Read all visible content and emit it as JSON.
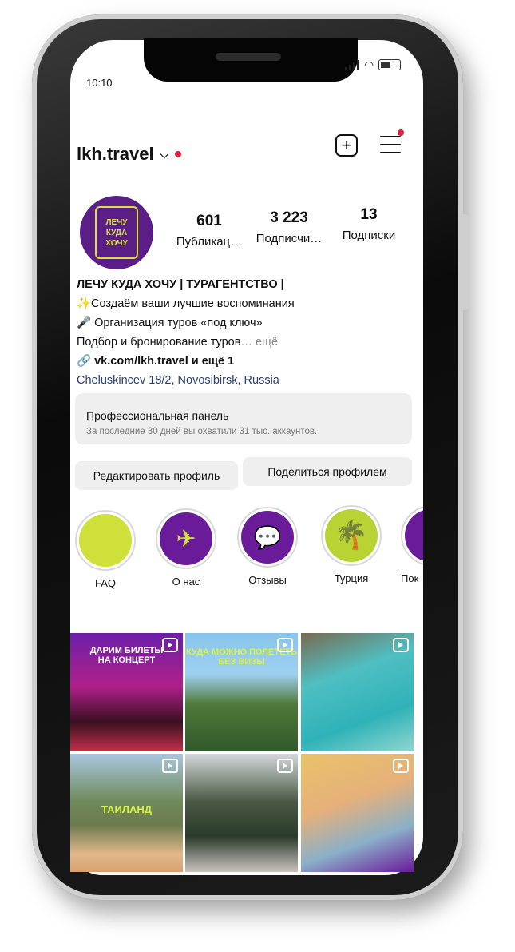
{
  "status": {
    "time": "10:10"
  },
  "header": {
    "username": "lkh.travel"
  },
  "avatar": {
    "logo_lines": [
      "ЛЕЧУ",
      "КУДА",
      "ХОЧУ"
    ]
  },
  "stats": [
    {
      "value": "601",
      "label": "Публикац…"
    },
    {
      "value": "3 223",
      "label": "Подписчи…"
    },
    {
      "value": "13",
      "label": "Подписки"
    }
  ],
  "bio": {
    "name": "ЛЕЧУ КУДА ХОЧУ | ТУРАГЕНТСТВО |",
    "line1": "✨Создаём ваши лучшие воспоминания",
    "line2": "🎤 Организация туров «под ключ»",
    "line3": "Подбор и бронирование туров",
    "more": "… ещё",
    "link": "vk.com/lkh.travel и ещё 1",
    "location": "Cheluskincev 18/2, Novosibirsk, Russia"
  },
  "pro_panel": {
    "title": "Профессиональная панель",
    "subtitle": "За последние 30 дней вы охватили 31 тыс. аккаунтов."
  },
  "actions": {
    "edit": "Редактировать профиль",
    "share": "Поделиться профилем"
  },
  "highlights": [
    {
      "label": "FAQ",
      "color": "#cfe03a"
    },
    {
      "label": "О нас",
      "color": "#6a1b9a"
    },
    {
      "label": "Отзывы",
      "color": "#6a1b9a"
    },
    {
      "label": "Турция",
      "color": "#b9d334"
    },
    {
      "label": "Пок",
      "color": "#6a1b9a"
    }
  ],
  "posts": [
    {
      "text": "ДАРИМ БИЛЕТЫ\nНА КОНЦЕРТ"
    },
    {
      "text": "КУДА МОЖНО ПОЛЕТЕТЬ\nБЕЗ ВИЗЫ"
    },
    {
      "text": ""
    },
    {
      "text": "ТАИЛАНД"
    },
    {
      "text": ""
    },
    {
      "text": ""
    }
  ]
}
